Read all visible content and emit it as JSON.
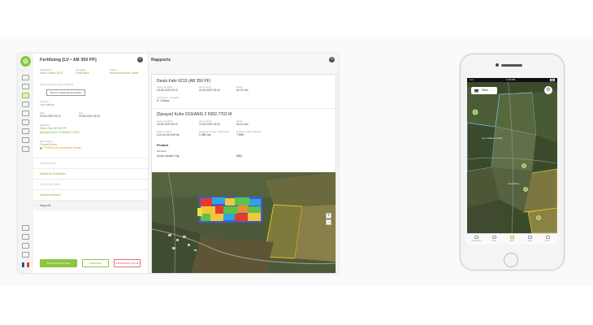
{
  "desktop": {
    "left_panel": {
      "title": "Fertilizing [LV • AB 350 PF]",
      "rows": [
        {
          "label": "Exploitation",
          "value": "Mavic Unified 2019"
        },
        {
          "label": "Campaign",
          "value": "Fertilization"
        },
        {
          "label": "Culture",
          "value": "Wheat soft winter wheat"
        }
      ],
      "equipment_label": "Seed / Products used / Fertilizers",
      "equipment_button": "Bruere / Grattel Ressemination",
      "location_label": "Location",
      "location_value": "Les chalons",
      "start_label": "Start",
      "start_value": "23.03.2020 09:13",
      "end_label": "End",
      "end_value": "23.03.2020 15:34",
      "operators_label": "Operators",
      "operators": [
        "Deutz-Fahr AB 350 PF",
        "[Sprayer] Kuhn OCEANIS 2 5002"
      ],
      "interventions_label": "Interventions",
      "intervention_value": "Promis Bruere",
      "intervention_note": "Fertilizer per modulation details",
      "sections": [
        {
          "label": "Observations",
          "style": "gray"
        },
        {
          "label": "Details fix Fertilization",
          "style": "green"
        },
        {
          "label": "Cost of operation",
          "style": "gray"
        },
        {
          "label": "Validate reactions",
          "style": "green"
        },
        {
          "label": "Rapports",
          "style": "dark"
        }
      ],
      "buttons": {
        "primary": "DUPLICATE ACTION",
        "secondary": "MODIFIER",
        "danger": "SUPPRIMER TACHE"
      }
    },
    "right_panel": {
      "title": "Rapports",
      "report1": {
        "title": "Deutz-Fahr 6215 (AB 350 PF)",
        "cols": [
          {
            "label": "Heure de début",
            "value": "23.03.2020 09:13"
          },
          {
            "label": "Heure de fin",
            "value": "23.03.2020 15:34"
          },
          {
            "label": "Durée",
            "value": "6h 21 min"
          }
        ],
        "sub_label": "Conducteur enregistré",
        "sub_value": "R. Collaud"
      },
      "report2": {
        "title": "[Sprayer] Kuhn OCEANIS 2 5002-7702 M",
        "cols": [
          {
            "label": "Heure de début",
            "value": "23.03.2020 09:13"
          },
          {
            "label": "Heure de fin",
            "value": "23.03.2020 15:34"
          },
          {
            "label": "Durée",
            "value": "6h 21 min"
          }
        ],
        "cols2": [
          {
            "label": "Surface traitée",
            "value": "6.24 ha de 6.89 ha"
          },
          {
            "label": "Moyenne du taux d'application",
            "value": "1.256 l/ha"
          },
          {
            "label": "Quantité totale appliquée",
            "value": "7.838 l"
          }
        ],
        "product_title": "Produit",
        "product_sub": "Nitrofertil",
        "product_name": "Koran Liquide 3 kg",
        "product_qty": "8861"
      }
    }
  },
  "phone": {
    "time": "1:20 PM",
    "carrier": "••••• ",
    "filter_label": "Filtrer",
    "pin_labels": [
      "Les Chalons Fields",
      "Grand Pré"
    ],
    "tabs": [
      "Operations",
      "Tasks",
      "Map",
      "Chat",
      "More"
    ],
    "active_tab": 2
  }
}
